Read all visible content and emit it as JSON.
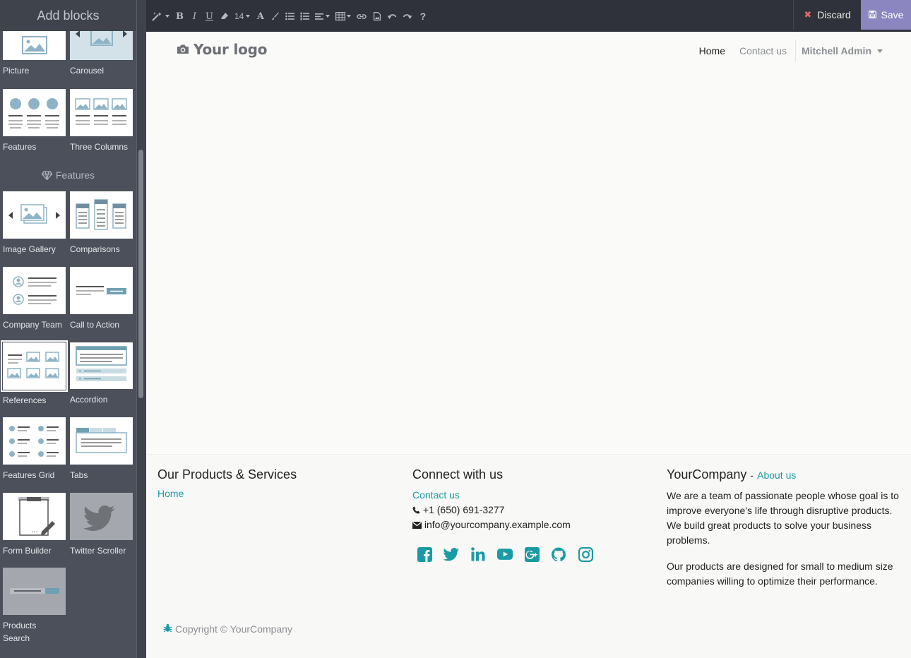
{
  "sidebar": {
    "title": "Add blocks",
    "category_features": "Features",
    "snippets": {
      "picture": "Picture",
      "carousel": "Carousel",
      "features": "Features",
      "three_columns": "Three Columns",
      "image_gallery": "Image Gallery",
      "comparisons": "Comparisons",
      "company_team": "Company Team",
      "call_to_action": "Call to Action",
      "references": "References",
      "accordion": "Accordion",
      "features_grid": "Features Grid",
      "tabs": "Tabs",
      "form_builder": "Form Builder",
      "twitter_scroller": "Twitter Scroller",
      "products_search": "Products Search"
    }
  },
  "toolbar": {
    "font_size": "14",
    "discard_label": "Discard",
    "save_label": "Save"
  },
  "header": {
    "logo_text": "Your logo",
    "nav_home": "Home",
    "nav_contact": "Contact us",
    "user_name": "Mitchell Admin"
  },
  "footer": {
    "col1": {
      "title": "Our Products & Services",
      "link": "Home"
    },
    "col2": {
      "title": "Connect with us",
      "contact_link": "Contact us",
      "phone": "+1 (650) 691-3277",
      "email": "info@yourcompany.example.com"
    },
    "col3": {
      "company": "YourCompany",
      "dash": "-",
      "about_link": "About us",
      "para1": "We are a team of passionate people whose goal is to improve everyone's life through disruptive products. We build great products to solve your business problems.",
      "para2": "Our products are designed for small to medium size companies willing to optimize their performance."
    },
    "copyright": "Copyright © YourCompany"
  },
  "colors": {
    "sidebar_bg": "#4b505a",
    "toolbar_bg": "#2f323a",
    "save_bg": "#8b85c0",
    "link": "#1a9aa4",
    "discard_icon": "#e16a6a"
  }
}
